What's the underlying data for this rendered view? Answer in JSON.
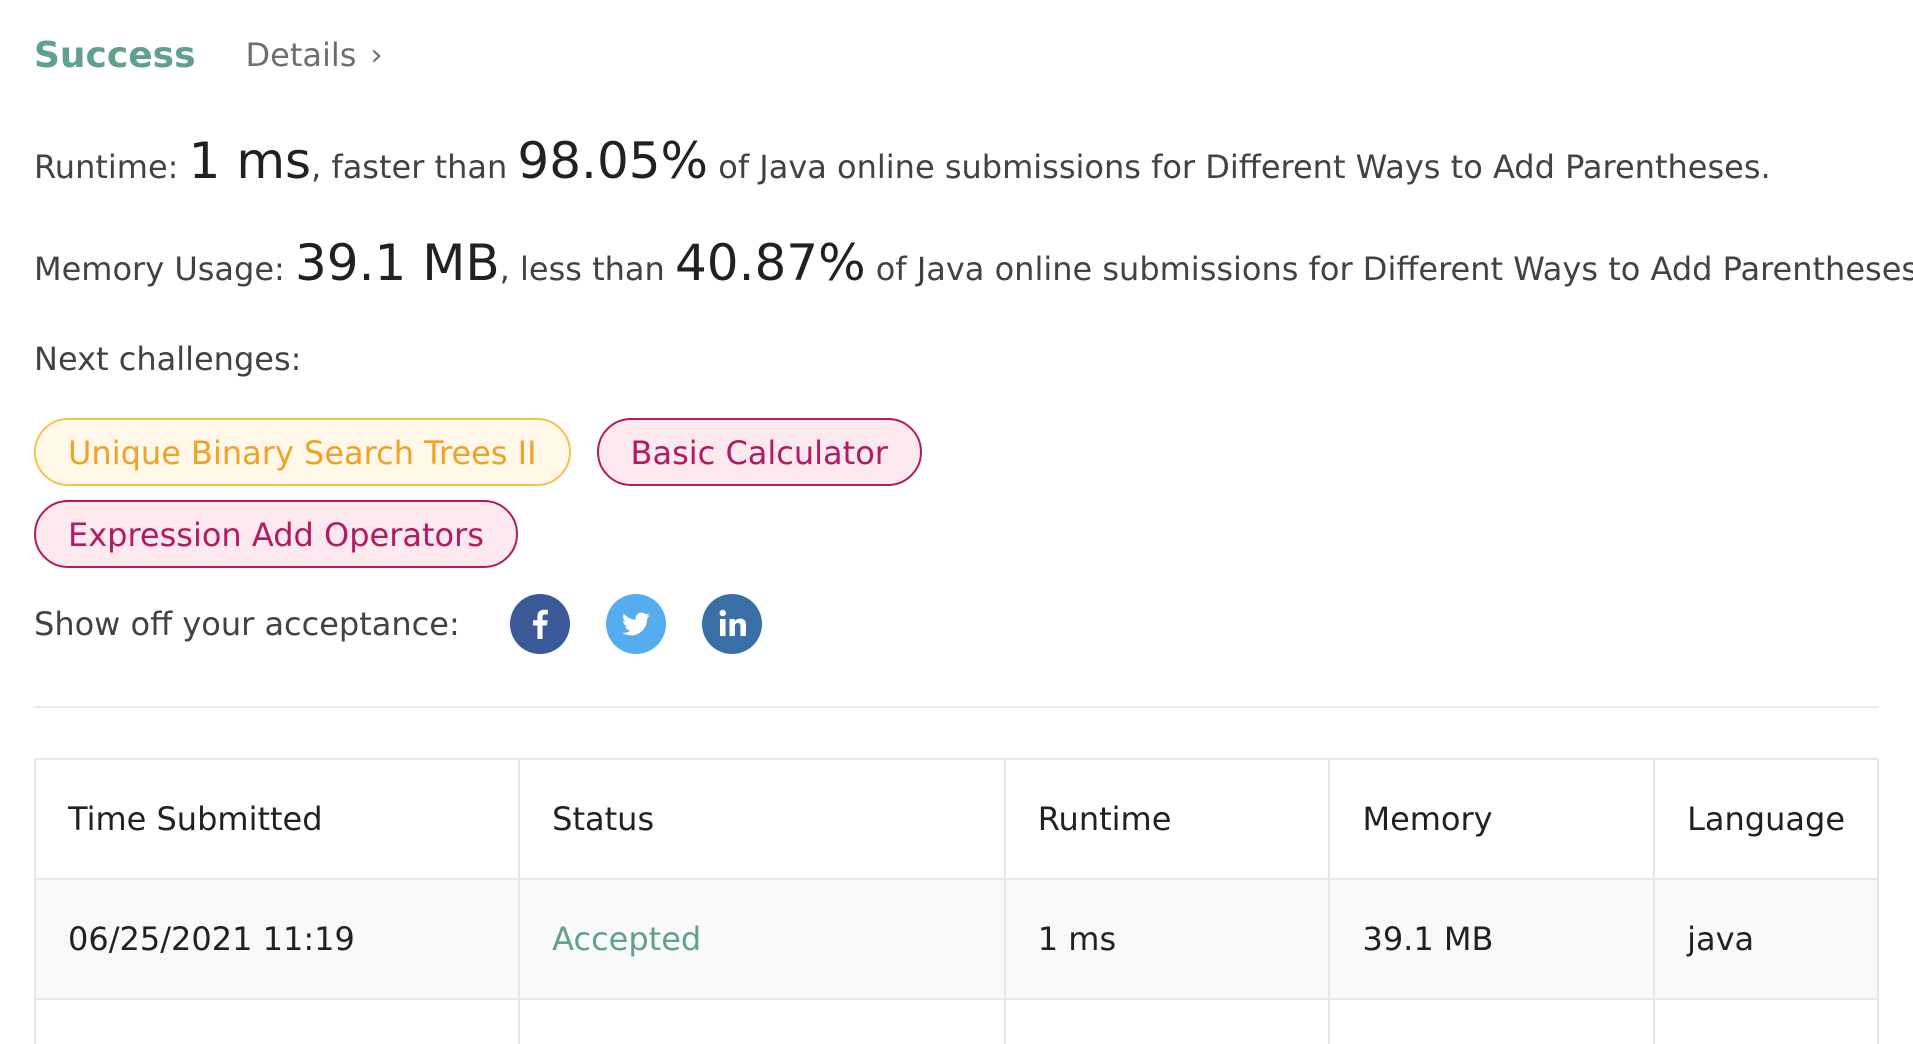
{
  "header": {
    "status": "Success",
    "details_label": "Details",
    "details_chevron": "›"
  },
  "runtime": {
    "label": "Runtime: ",
    "value": "1 ms",
    "comparison": ", faster than ",
    "percentile": "98.05%",
    "suffix": " of Java online submissions for Different Ways to Add Parentheses."
  },
  "memory": {
    "label": "Memory Usage: ",
    "value": "39.1 MB",
    "comparison": ", less than ",
    "percentile": "40.87%",
    "suffix": " of Java online submissions for Different Ways to Add Parentheses."
  },
  "next_challenges": {
    "label": "Next challenges:",
    "items": [
      {
        "label": "Unique Binary Search Trees II",
        "difficulty_color": "#f0a228"
      },
      {
        "label": "Basic Calculator",
        "difficulty_color": "#b01b63"
      },
      {
        "label": "Expression Add Operators",
        "difficulty_color": "#b01b63"
      }
    ]
  },
  "share": {
    "label": "Show off your acceptance:",
    "icons": [
      "facebook-icon",
      "twitter-icon",
      "linkedin-icon"
    ]
  },
  "colors": {
    "success": "#5fa08f",
    "medium": "#f0a228",
    "hard": "#b01b63",
    "facebook": "#3b5998",
    "twitter": "#55acee",
    "linkedin": "#3a6fa5"
  },
  "submissions": {
    "columns": [
      "Time Submitted",
      "Status",
      "Runtime",
      "Memory",
      "Language"
    ],
    "rows": [
      {
        "time": "06/25/2021 11:19",
        "status": "Accepted",
        "runtime": "1 ms",
        "memory": "39.1 MB",
        "language": "java"
      }
    ]
  }
}
